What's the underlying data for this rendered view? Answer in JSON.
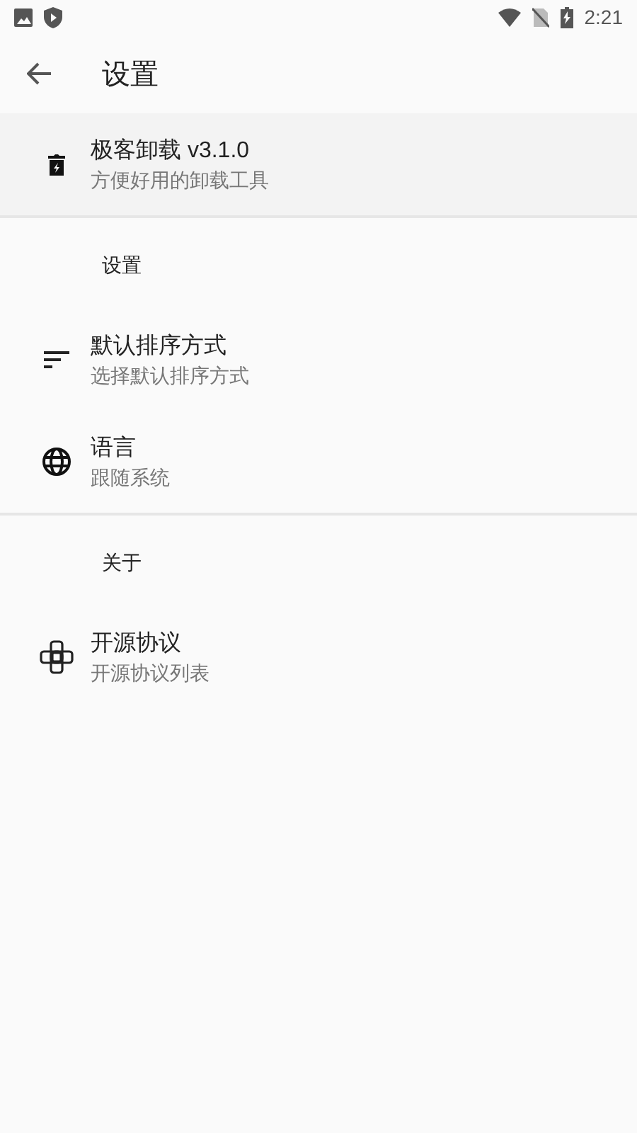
{
  "status_bar": {
    "time": "2:21"
  },
  "app_bar": {
    "title": "设置"
  },
  "header": {
    "kind": "app",
    "title": "极客卸载 v3.1.0",
    "subtitle": "方便好用的卸载工具"
  },
  "sections": [
    {
      "title": "设置",
      "items": [
        {
          "kind": "sort",
          "title": "默认排序方式",
          "subtitle": "选择默认排序方式"
        },
        {
          "kind": "globe",
          "title": "语言",
          "subtitle": "跟随系统"
        }
      ]
    },
    {
      "title": "关于",
      "items": [
        {
          "kind": "license",
          "title": "开源协议",
          "subtitle": "开源协议列表"
        }
      ]
    }
  ]
}
